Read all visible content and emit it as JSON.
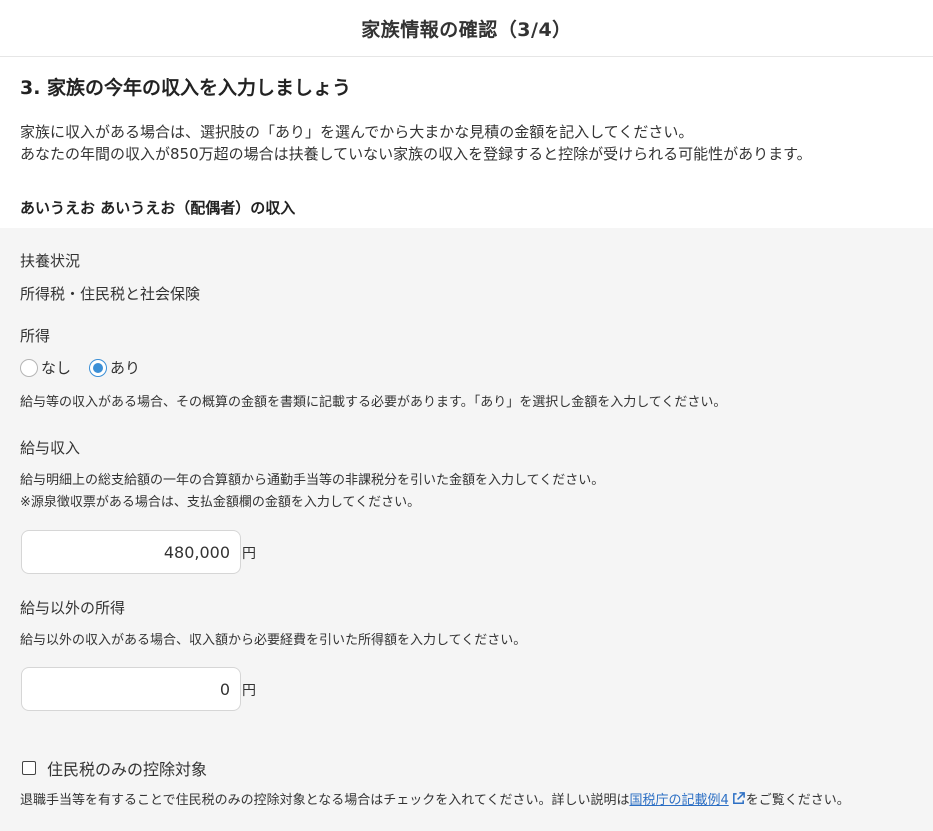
{
  "header": {
    "title": "家族情報の確認（3/4）"
  },
  "section": {
    "title": "3. 家族の今年の収入を入力しましょう",
    "intro_line1": "家族に収入がある場合は、選択肢の「あり」を選んでから大まかな見積の金額を記入してください。",
    "intro_line2": "あなたの年間の収入が850万超の場合は扶養していない家族の収入を登録すると控除が受けられる可能性があります。"
  },
  "person": {
    "title": "あいうえお あいうえお（配偶者）の収入"
  },
  "dependency": {
    "label": "扶養状況",
    "value": "所得税・住民税と社会保険"
  },
  "income": {
    "label": "所得",
    "options": [
      {
        "label": "なし",
        "checked": false
      },
      {
        "label": "あり",
        "checked": true
      }
    ],
    "note": "給与等の収入がある場合、その概算の金額を書類に記載する必要があります。「あり」を選択し金額を入力してください。"
  },
  "salary": {
    "label": "給与収入",
    "note_line1": "給与明細上の総支給額の一年の合算額から通勤手当等の非課税分を引いた金額を入力してください。",
    "note_line2": "※源泉徴収票がある場合は、支払金額欄の金額を入力してください。",
    "value": "480,000",
    "unit": "円"
  },
  "other_income": {
    "label": "給与以外の所得",
    "note": "給与以外の収入がある場合、収入額から必要経費を引いた所得額を入力してください。",
    "value": "0",
    "unit": "円"
  },
  "resident_tax": {
    "label": "住民税のみの控除対象",
    "checked": false,
    "note_before": "退職手当等を有することで住民税のみの控除対象となる場合はチェックを入れてください。詳しい説明は",
    "link_text": "国税庁の記載例4",
    "note_after": "をご覧ください。"
  },
  "colors": {
    "accent": "#3b8fd6",
    "link": "#2c6fc4",
    "panel_bg": "#f5f5f5"
  },
  "icons": {
    "external_link": "external-link-icon"
  }
}
